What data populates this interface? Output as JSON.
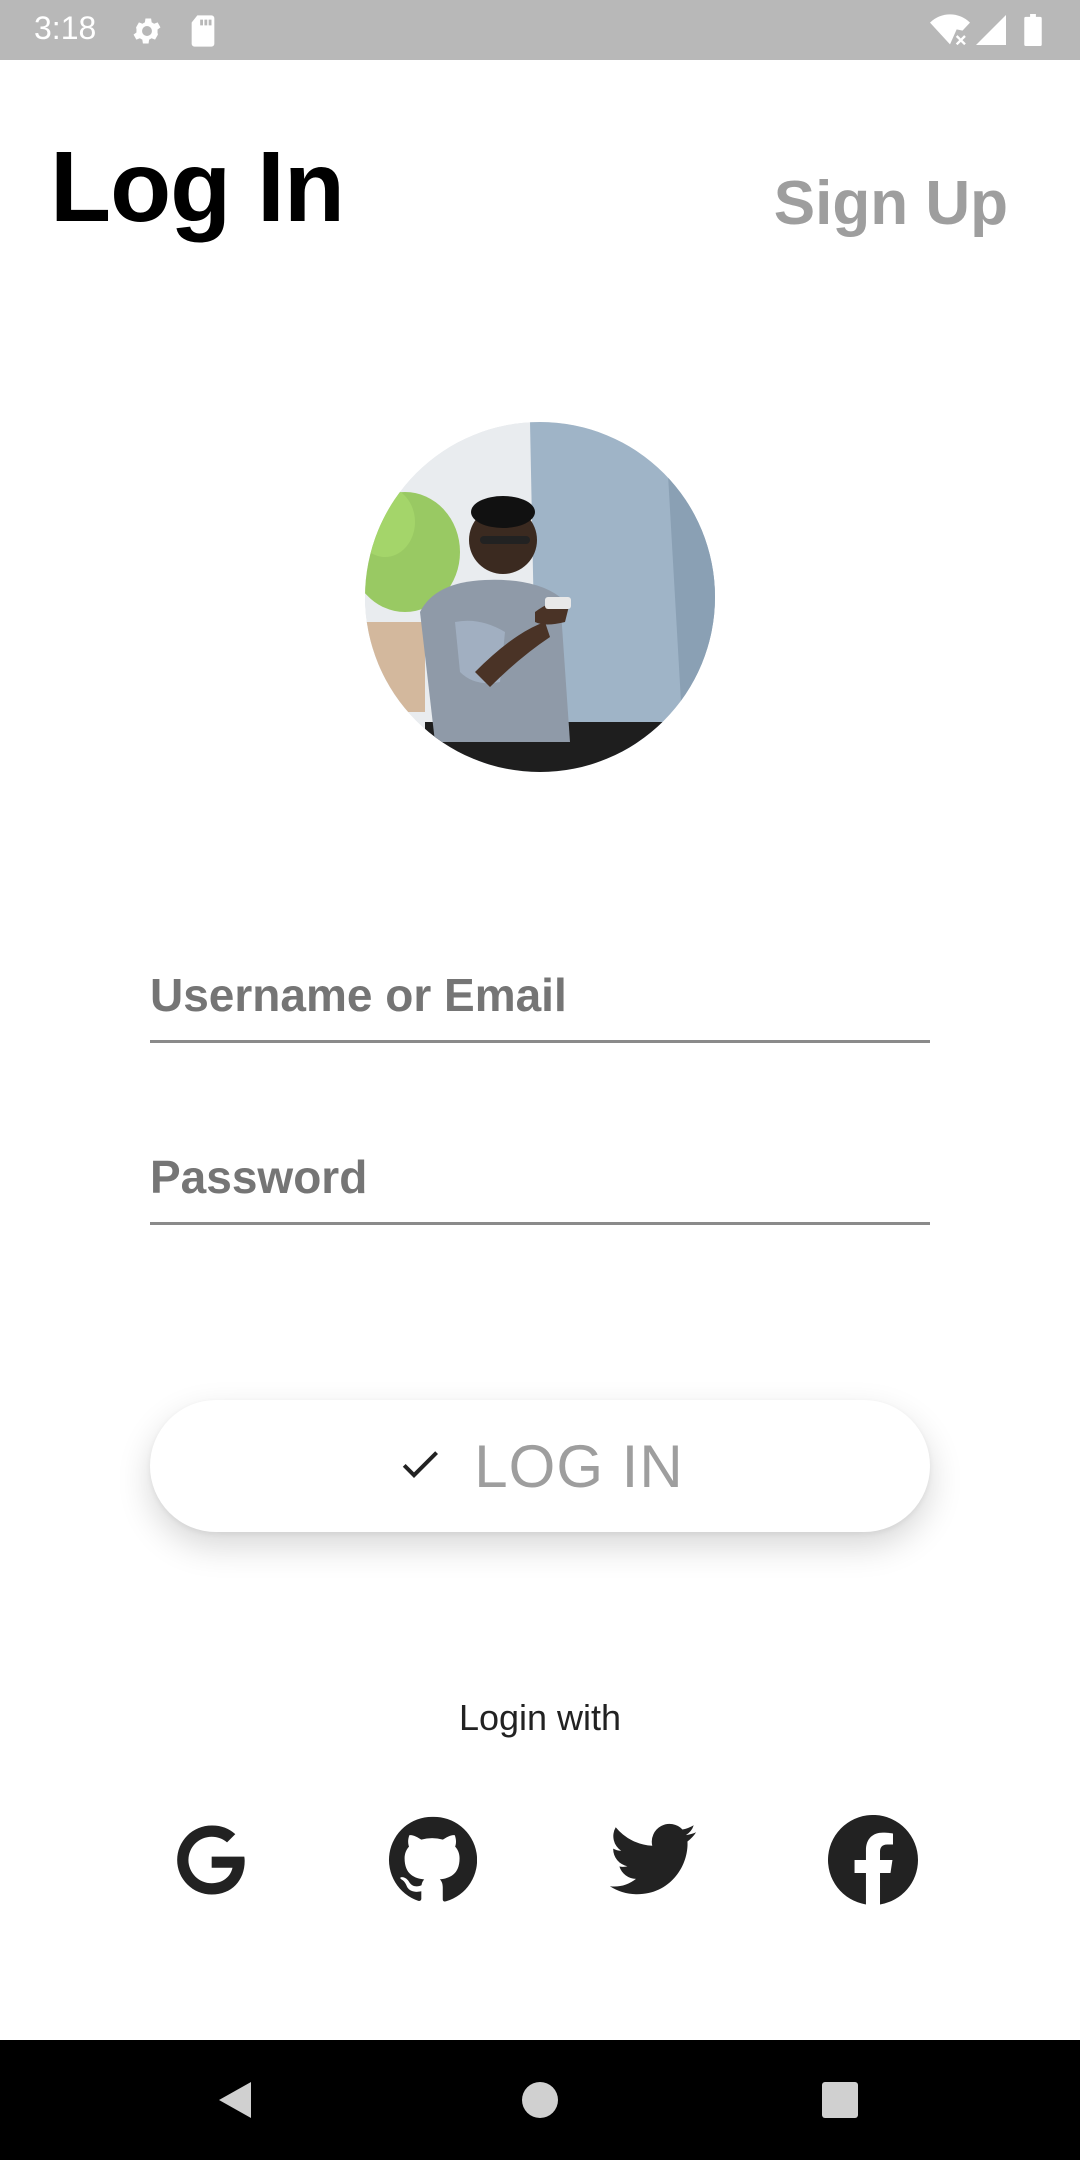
{
  "status_bar": {
    "time": "3:18",
    "icons": [
      "gear-icon",
      "sd-card-icon",
      "wifi-off-icon",
      "signal-icon",
      "battery-icon"
    ]
  },
  "header": {
    "title": "Log In",
    "signup_label": "Sign Up"
  },
  "avatar": {
    "description_icon": "profile-photo"
  },
  "form": {
    "username_placeholder": "Username or Email",
    "username_value": "",
    "password_placeholder": "Password",
    "password_value": ""
  },
  "login_button": {
    "label": "LOG IN",
    "icon": "check-icon"
  },
  "social": {
    "heading": "Login with",
    "providers": [
      "google-icon",
      "github-icon",
      "twitter-icon",
      "facebook-icon"
    ]
  },
  "nav_bar": {
    "buttons": [
      "back-icon",
      "home-icon",
      "recents-icon"
    ]
  },
  "colors": {
    "status_bar_bg": "#b8b8b8",
    "title": "#000000",
    "muted": "#9e9e9e",
    "social_icon": "#222222",
    "nav_bar_bg": "#000000"
  }
}
